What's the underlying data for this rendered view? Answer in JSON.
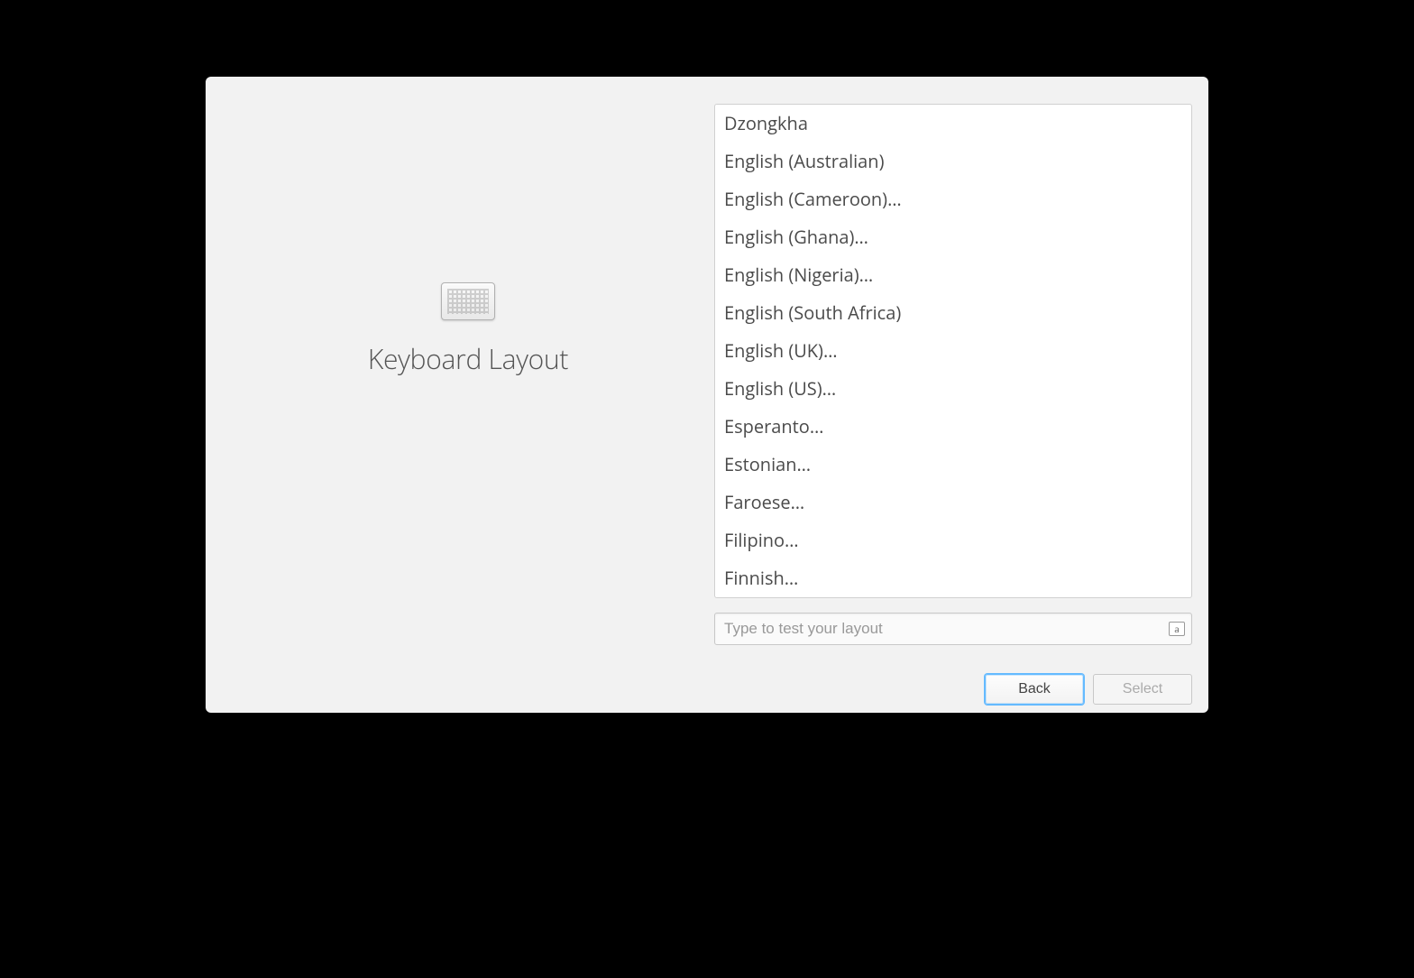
{
  "header": {
    "title": "Keyboard Layout"
  },
  "layouts": [
    "Dzongkha",
    "English (Australian)",
    "English (Cameroon)…",
    "English (Ghana)…",
    "English (Nigeria)…",
    "English (South Africa)",
    "English (UK)…",
    "English (US)…",
    "Esperanto…",
    "Estonian…",
    "Faroese…",
    "Filipino…",
    "Finnish…"
  ],
  "test_input": {
    "placeholder": "Type to test your layout",
    "indicator": "a"
  },
  "buttons": {
    "back": "Back",
    "select": "Select"
  }
}
